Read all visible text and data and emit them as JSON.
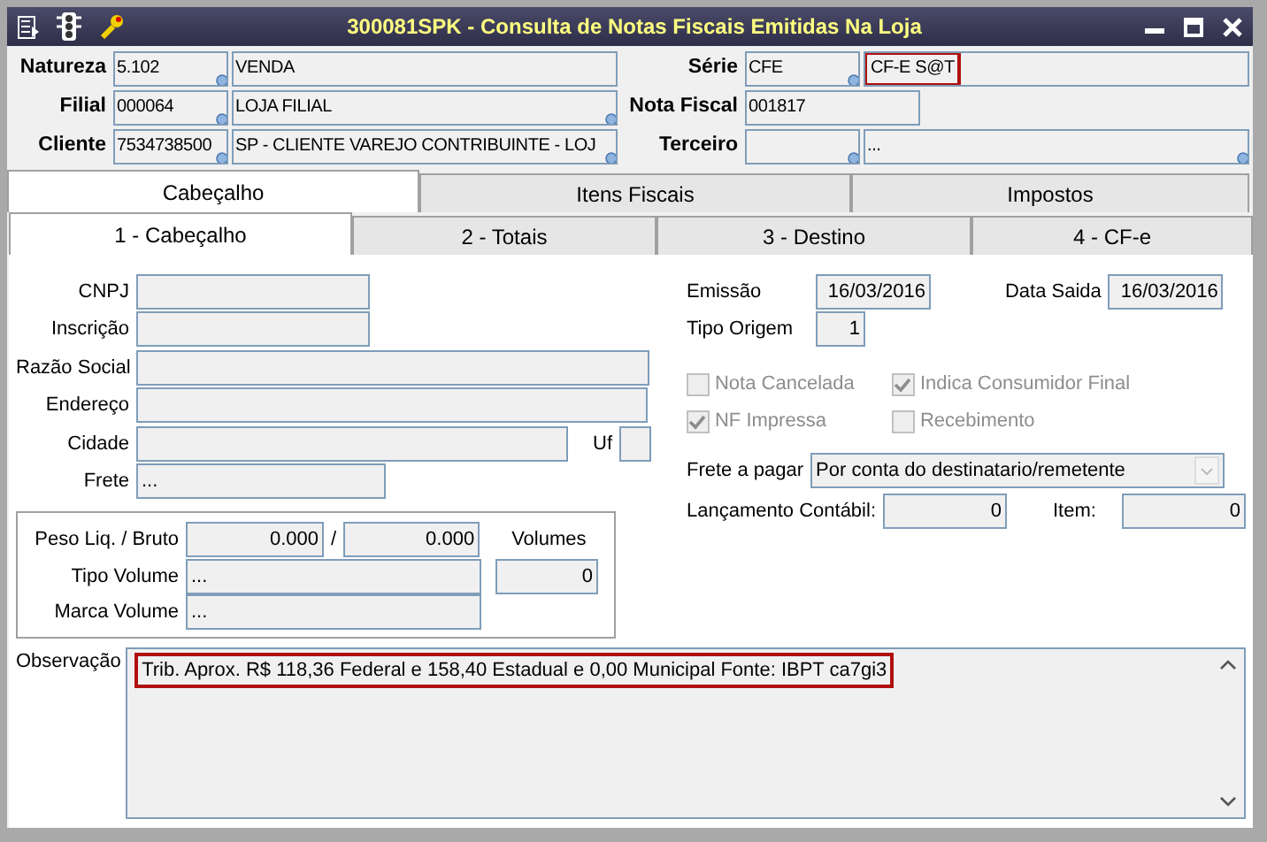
{
  "window": {
    "title": "300081SPK - Consulta de Notas Fiscais Emitidas Na Loja"
  },
  "header": {
    "left": [
      {
        "label": "Natureza",
        "fields": [
          {
            "kind": "code",
            "value": "5.102",
            "lookup": true
          },
          {
            "kind": "desc",
            "value": "VENDA",
            "lookup": false
          }
        ]
      },
      {
        "label": "Filial",
        "fields": [
          {
            "kind": "code",
            "value": "000064",
            "lookup": true
          },
          {
            "kind": "desc",
            "value": "LOJA FILIAL",
            "lookup": true
          }
        ]
      },
      {
        "label": "Cliente",
        "fields": [
          {
            "kind": "code",
            "value": "7534738500",
            "lookup": true
          },
          {
            "kind": "desc",
            "value": "SP - CLIENTE VAREJO CONTRIBUINTE - LOJ",
            "lookup": true
          }
        ]
      }
    ],
    "right": [
      {
        "label": "Série",
        "fields": [
          {
            "kind": "code",
            "value": "CFE",
            "lookup": true
          },
          {
            "kind": "desc",
            "value": "CF-E S@T",
            "lookup": false,
            "highlighted": true
          }
        ]
      },
      {
        "label": "Nota Fiscal",
        "fields": [
          {
            "kind": "short",
            "value": "001817",
            "lookup": false
          }
        ]
      },
      {
        "label": "Terceiro",
        "fields": [
          {
            "kind": "code",
            "lookup": true
          },
          {
            "kind": "desc",
            "value": "...",
            "lookup": true
          }
        ]
      }
    ]
  },
  "tabs": [
    {
      "label": "Cabeçalho",
      "selected": true
    },
    {
      "label": "Itens Fiscais",
      "selected": false
    },
    {
      "label": "Impostos",
      "selected": false
    }
  ],
  "subtabs": [
    {
      "label": "1 - Cabeçalho",
      "selected": true
    },
    {
      "label": "2 - Totais",
      "selected": false
    },
    {
      "label": "3 - Destino",
      "selected": false
    },
    {
      "label": "4 - CF-e",
      "selected": false
    }
  ],
  "details": [
    {
      "label": "CNPJ"
    },
    {
      "label": "Inscrição"
    },
    {
      "label": "Razão Social"
    },
    {
      "label": "Endereço"
    },
    {
      "label": "Cidade"
    },
    {
      "label": "Uf",
      "kind": "inline"
    },
    {
      "label": "Frete",
      "value": "..."
    }
  ],
  "volume_box": {
    "peso_label": "Peso Liq. / Bruto",
    "liquido": "0.000",
    "separator": "/",
    "bruto": "0.000",
    "volumes_label": "Volumes",
    "tipo_label": "Tipo Volume",
    "tipo_value": "...",
    "volumes_value": "0",
    "marca_label": "Marca Volume",
    "marca_value": "..."
  },
  "dates": {
    "emissao_label": "Emissão",
    "emissao": "16/03/2016",
    "saida_label": "Data Saida",
    "saida": "16/03/2016",
    "origem_label": "Tipo Origem",
    "origem": "1"
  },
  "checkboxes": [
    {
      "label": "Nota Cancelada",
      "checked": false,
      "disabled": true
    },
    {
      "label": "Indica Consumidor Final",
      "checked": true,
      "disabled": true
    },
    {
      "label": "NF Impressa",
      "checked": true,
      "disabled": true
    },
    {
      "label": "Recebimento",
      "checked": false,
      "disabled": true
    }
  ],
  "frete_a_pagar": {
    "label": "Frete a pagar",
    "value": "Por conta do destinatario/remetente"
  },
  "lancamento": {
    "label": "Lançamento Contábil:",
    "value": "0",
    "item_label": "Item:",
    "item_value": "0"
  },
  "observacao": {
    "label": "Observação",
    "text": "Trib. Aprox. R$ 118,36 Federal e 158,40 Estadual e 0,00 Municipal Fonte: IBPT ca7gi3",
    "highlighted": true
  }
}
